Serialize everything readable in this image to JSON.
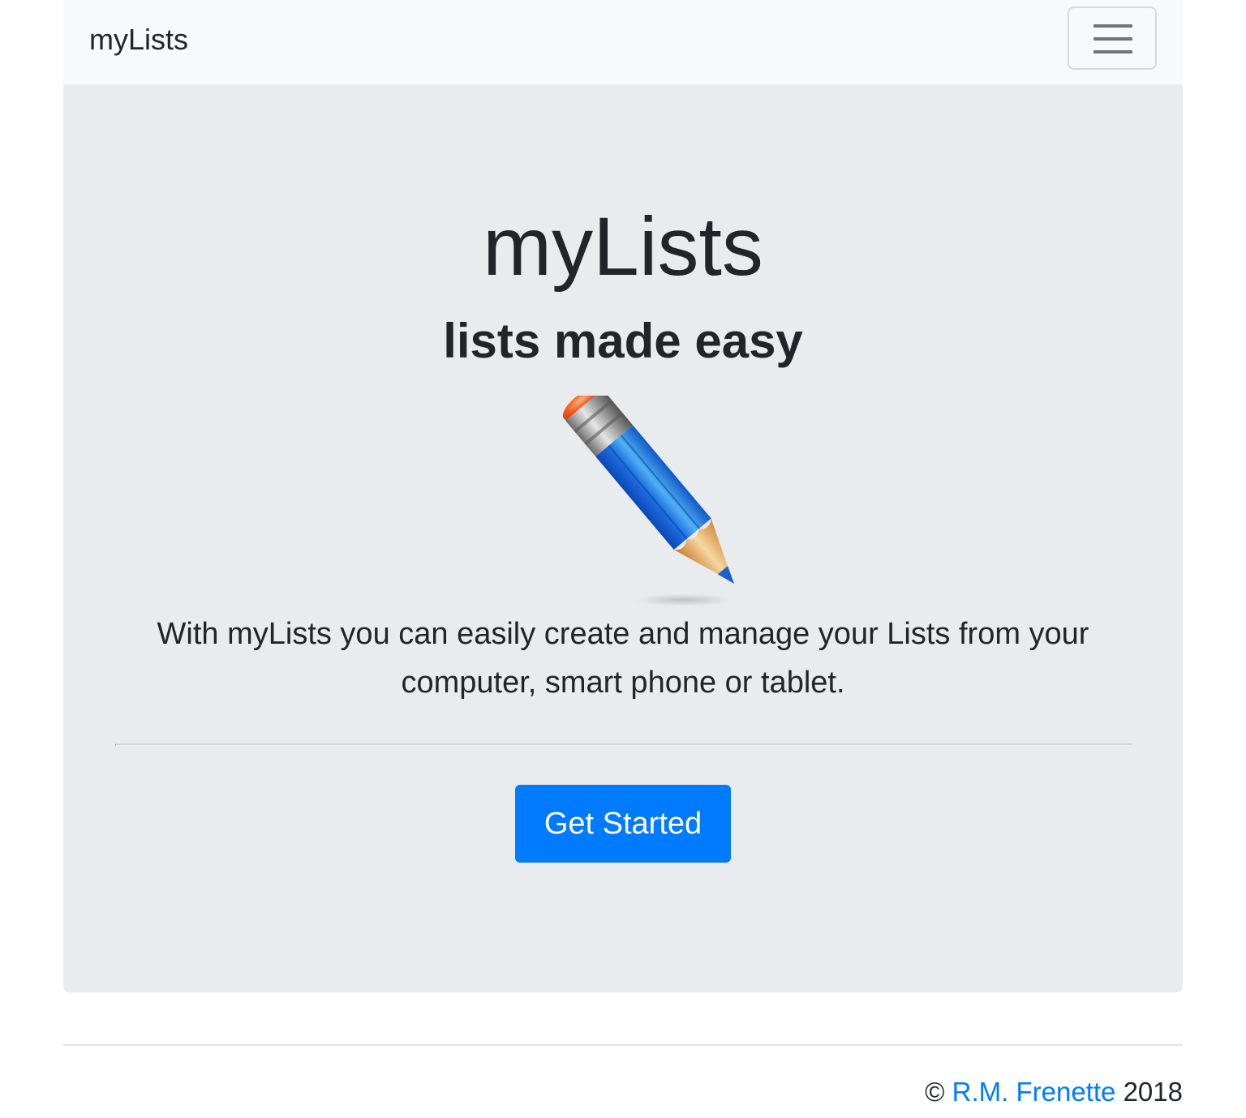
{
  "navbar": {
    "brand": "myLists",
    "toggler_icon": "hamburger-menu-icon"
  },
  "hero": {
    "title": "myLists",
    "subtitle": "lists made easy",
    "image_icon": "pencil-icon",
    "lead": "With myLists you can easily create and manage your Lists from your computer, smart phone or tablet.",
    "cta_label": "Get Started"
  },
  "footer": {
    "copyright_symbol": "©",
    "author": "R.M. Frenette",
    "year": "2018"
  },
  "colors": {
    "primary": "#007bff",
    "jumbotron_bg": "#e9ecef",
    "navbar_bg": "#f8f9fa",
    "text": "#212529"
  }
}
